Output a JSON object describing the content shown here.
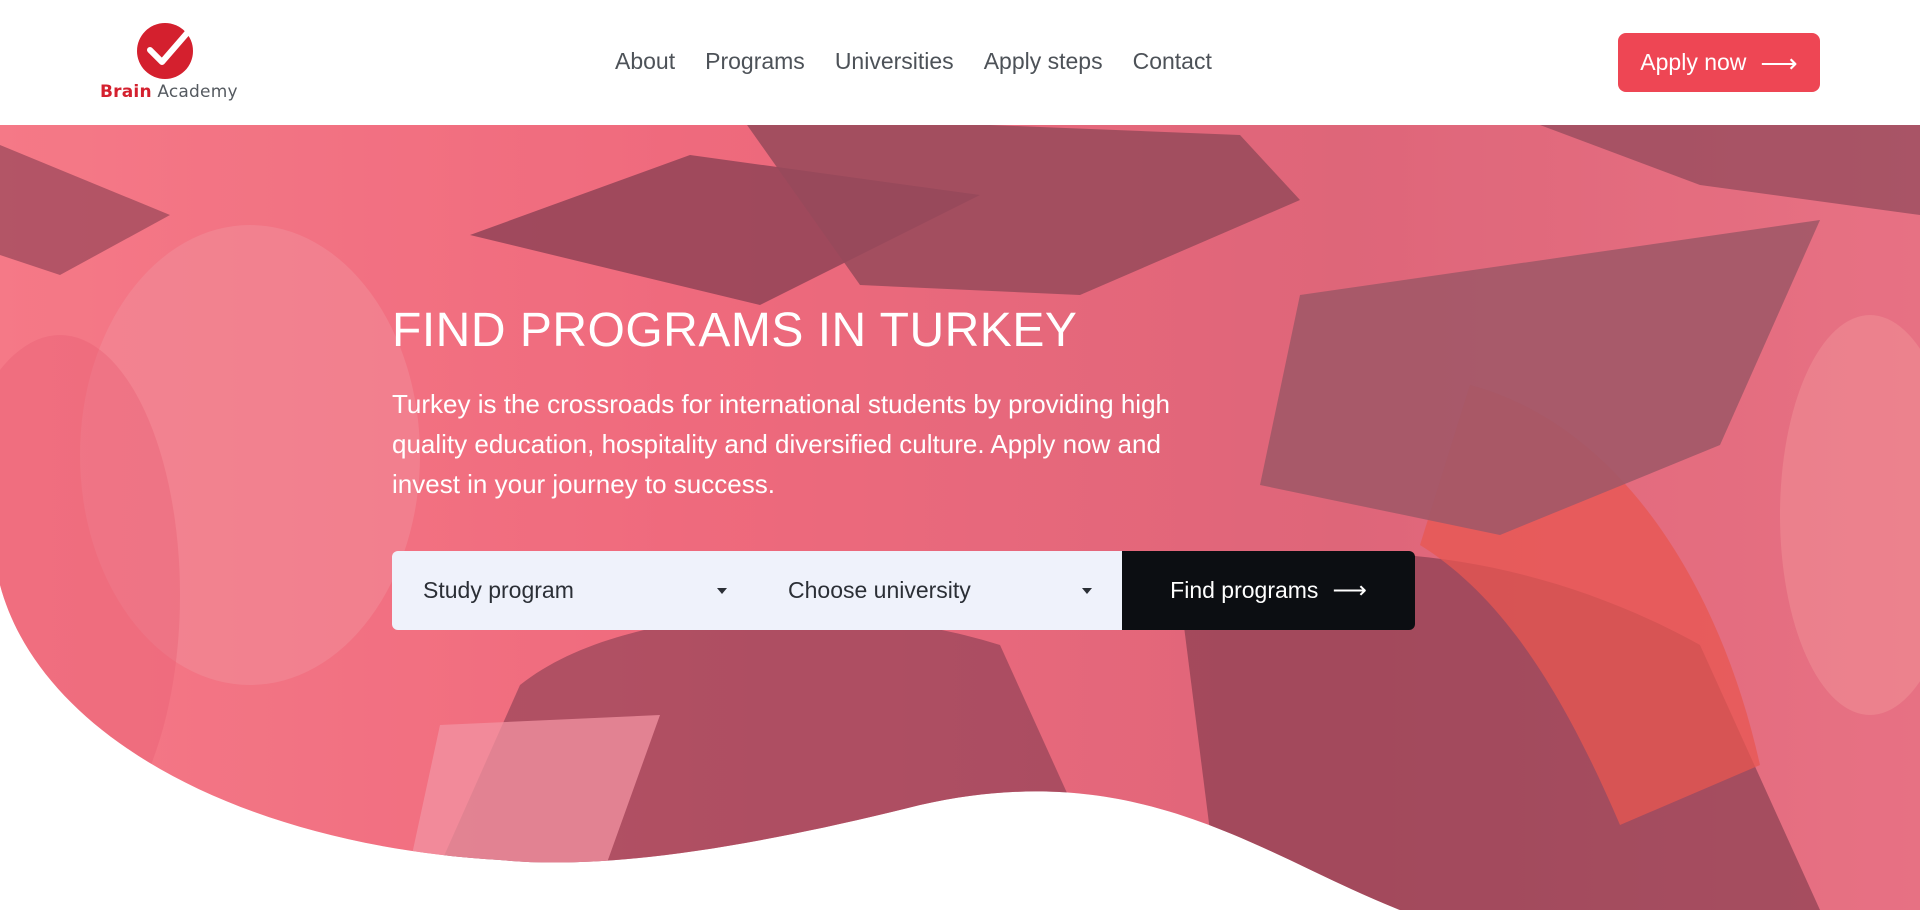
{
  "logo": {
    "brand": "Brain",
    "name": "Academy",
    "icon": "checkmark-circle-icon"
  },
  "nav": {
    "items": [
      {
        "label": "About"
      },
      {
        "label": "Programs"
      },
      {
        "label": "Universities"
      },
      {
        "label": "Apply steps"
      },
      {
        "label": "Contact"
      }
    ]
  },
  "header": {
    "apply_label": "Apply now",
    "apply_icon": "arrow-right-icon"
  },
  "hero": {
    "title": "FIND PROGRAMS IN TURKEY",
    "description": "Turkey is the crossroads for international students by providing high quality education, hospitality and diversified culture. Apply now and invest in your journey to success.",
    "background": "graduation-photo-red-overlay"
  },
  "search": {
    "program_select": {
      "value": "Study program",
      "icon": "caret-down-icon"
    },
    "university_select": {
      "value": "Choose university",
      "icon": "caret-down-icon"
    },
    "find_label": "Find programs",
    "find_icon": "arrow-right-icon"
  },
  "colors": {
    "brand_red": "#d4202e",
    "apply_button": "#ee4654",
    "overlay": "#f0596d",
    "dark_button": "#0c0e12",
    "select_bg": "#eff2fb"
  }
}
